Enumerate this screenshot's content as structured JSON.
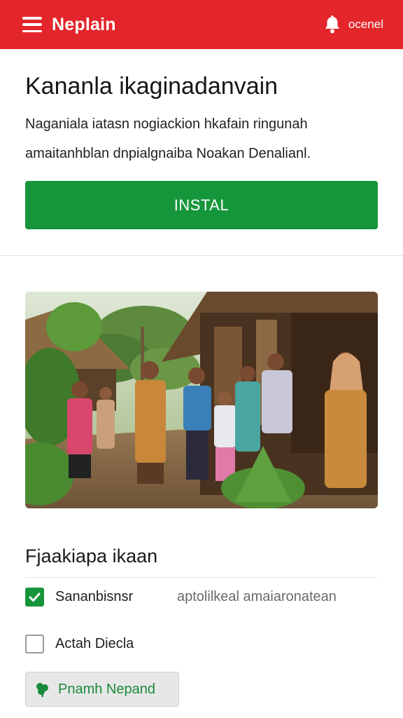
{
  "header": {
    "brand": "Neplain",
    "menu_icon": "hamburger-menu-icon",
    "notification_icon": "bell-icon",
    "account_label": "ocenel",
    "colors": {
      "background": "#e3262b",
      "text": "#ffffff"
    }
  },
  "hero": {
    "title": "Kananla ikaginadanvain",
    "description_line1": "Naganiala iatasn nogiackion hkafain ringunah",
    "description_line2": "amaitanhblan dnpialgnaiba Noakan Denalianl.",
    "install_label": "INSTAL",
    "colors": {
      "install_button": "#16963a"
    }
  },
  "photo": {
    "description_alt": "village-photo"
  },
  "options": {
    "section_title": "Fjaakiapa ikaan",
    "items": [
      {
        "label": "Sananbisnsr",
        "secondary": "aptolilkeal amaiaronatean",
        "checked": true
      },
      {
        "label": "Actah Diecla",
        "secondary": "",
        "checked": false
      }
    ],
    "secondary_button_label": "Pnamh Nepand",
    "secondary_button_icon": "leaf-icon",
    "colors": {
      "accent": "#17953a"
    }
  }
}
